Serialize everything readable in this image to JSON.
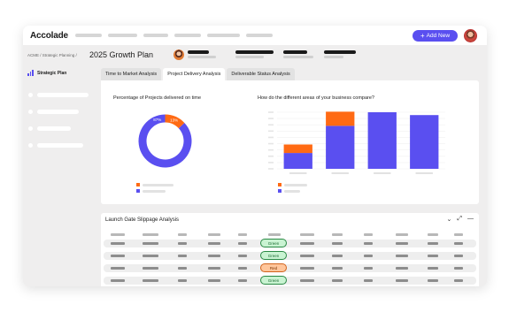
{
  "app": {
    "logo": "Accolade",
    "add_new_label": "Add New",
    "brand_color": "#5a4ff0"
  },
  "header": {
    "breadcrumb": "ACME / Strategic Planning /",
    "title": "2025 Growth Plan"
  },
  "sidebar": {
    "heading": "Strategic Plan",
    "icon": "bar-chart-icon"
  },
  "tabs": [
    {
      "label": "Time to Market Analysis",
      "active": false
    },
    {
      "label": "Project Delivery Analysis",
      "active": true
    },
    {
      "label": "Deliverable Status Analysis",
      "active": false
    }
  ],
  "donut": {
    "title": "Percentage of Projects delivered on time",
    "chart_data": {
      "type": "pie",
      "labels": [
        "",
        ""
      ],
      "values": [
        87,
        13
      ],
      "data_labels": [
        "87%",
        "13%"
      ],
      "colors": [
        "#5a4ff0",
        "#ff6a13"
      ]
    }
  },
  "bars": {
    "title": "How do the different areas of your business compare?",
    "chart_data": {
      "type": "bar",
      "stacked": true,
      "categories": [
        "",
        "",
        "",
        ""
      ],
      "ylim": [
        0,
        100
      ],
      "series": [
        {
          "color": "#5a4ff0",
          "values": [
            28,
            76,
            100,
            95
          ]
        },
        {
          "color": "#ff6a13",
          "values": [
            15,
            25,
            0,
            0
          ]
        }
      ]
    }
  },
  "gate": {
    "title": "Launch Gate Slippage Analysis",
    "rows": [
      {
        "status": "Green"
      },
      {
        "status": "Green"
      },
      {
        "status": "Red"
      },
      {
        "status": "Green"
      }
    ]
  }
}
